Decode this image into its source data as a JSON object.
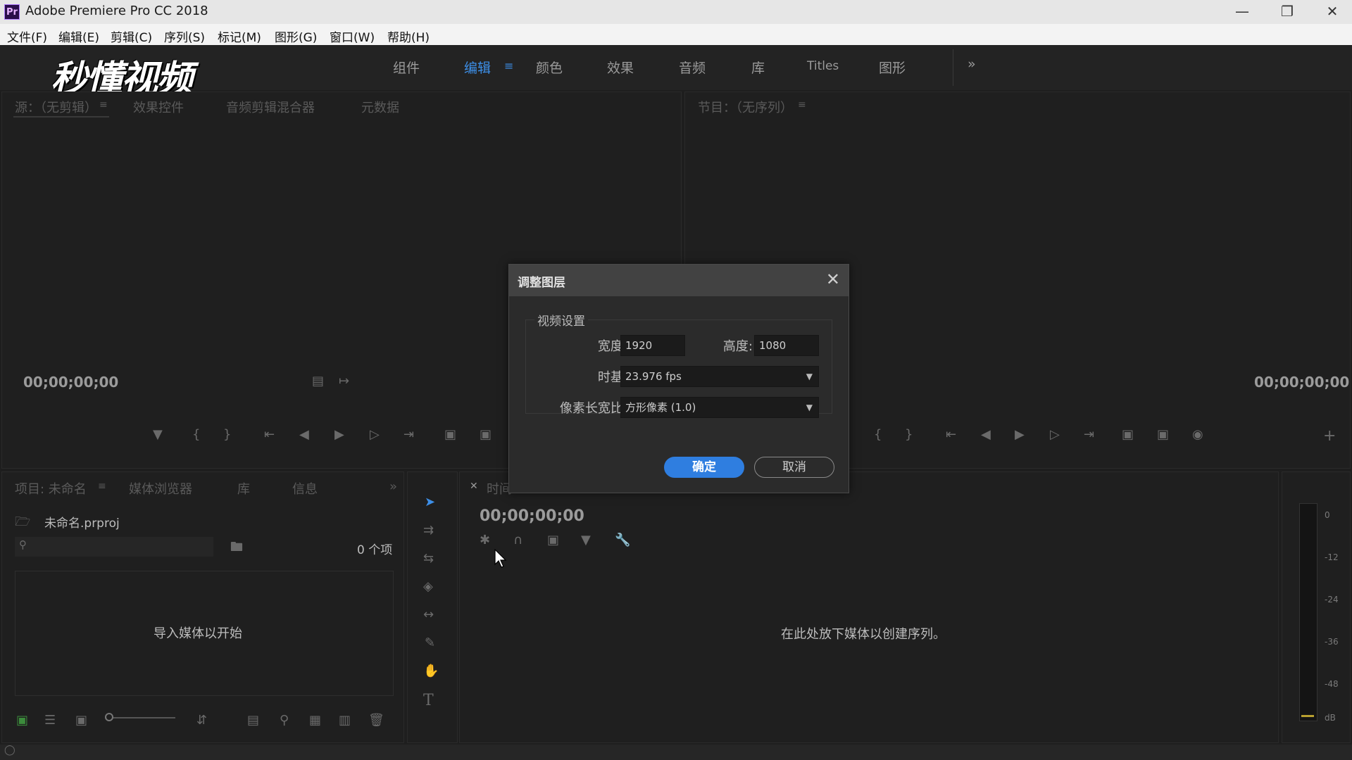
{
  "window": {
    "title": "Adobe Premiere Pro CC 2018",
    "app_icon": "Pr",
    "controls": [
      "minimize-icon",
      "restore-icon",
      "close-icon"
    ]
  },
  "menu": [
    "文件(F)",
    "编辑(E)",
    "剪辑(C)",
    "序列(S)",
    "标记(M)",
    "图形(G)",
    "窗口(W)",
    "帮助(H)"
  ],
  "workspace": {
    "logo": "秒懂视频",
    "tabs": [
      "组件",
      "编辑",
      "颜色",
      "效果",
      "音频",
      "库",
      "Titles",
      "图形"
    ],
    "active_tab": "编辑",
    "more": "»"
  },
  "source_panel": {
    "tabs": [
      "源：（无剪辑）",
      "效果控件",
      "音频剪辑混合器",
      "元数据"
    ],
    "timecode": "00;00;00;00"
  },
  "program_panel": {
    "tab": "节目：（无序列）",
    "timecode": "00;00;00;00"
  },
  "project_panel": {
    "tabs": [
      "项目: 未命名",
      "媒体浏览器",
      "库",
      "信息"
    ],
    "file_name": "未命名.prproj",
    "item_count": "0 个项",
    "empty_text": "导入媒体以开始"
  },
  "timeline_panel": {
    "tab_partial": "时间",
    "timecode": "00;00;00;00",
    "empty_text": "在此处放下媒体以创建序列。"
  },
  "audio_meter": {
    "labels": [
      "0",
      "-12",
      "-24",
      "-36",
      "-48",
      "dB"
    ]
  },
  "dialog": {
    "title": "调整图层",
    "group_label": "视频设置",
    "width_label": "宽度:",
    "width_value": "1920",
    "height_label": "高度:",
    "height_value": "1080",
    "timebase_label": "时基:",
    "timebase_value": "23.976 fps",
    "par_label": "像素长宽比:",
    "par_value": "方形像素 (1.0)",
    "ok_label": "确定",
    "cancel_label": "取消"
  },
  "colors": {
    "accent": "#2f7ee0",
    "panel_bg": "#1f1f1f",
    "active_tab": "#3d8fe8"
  }
}
